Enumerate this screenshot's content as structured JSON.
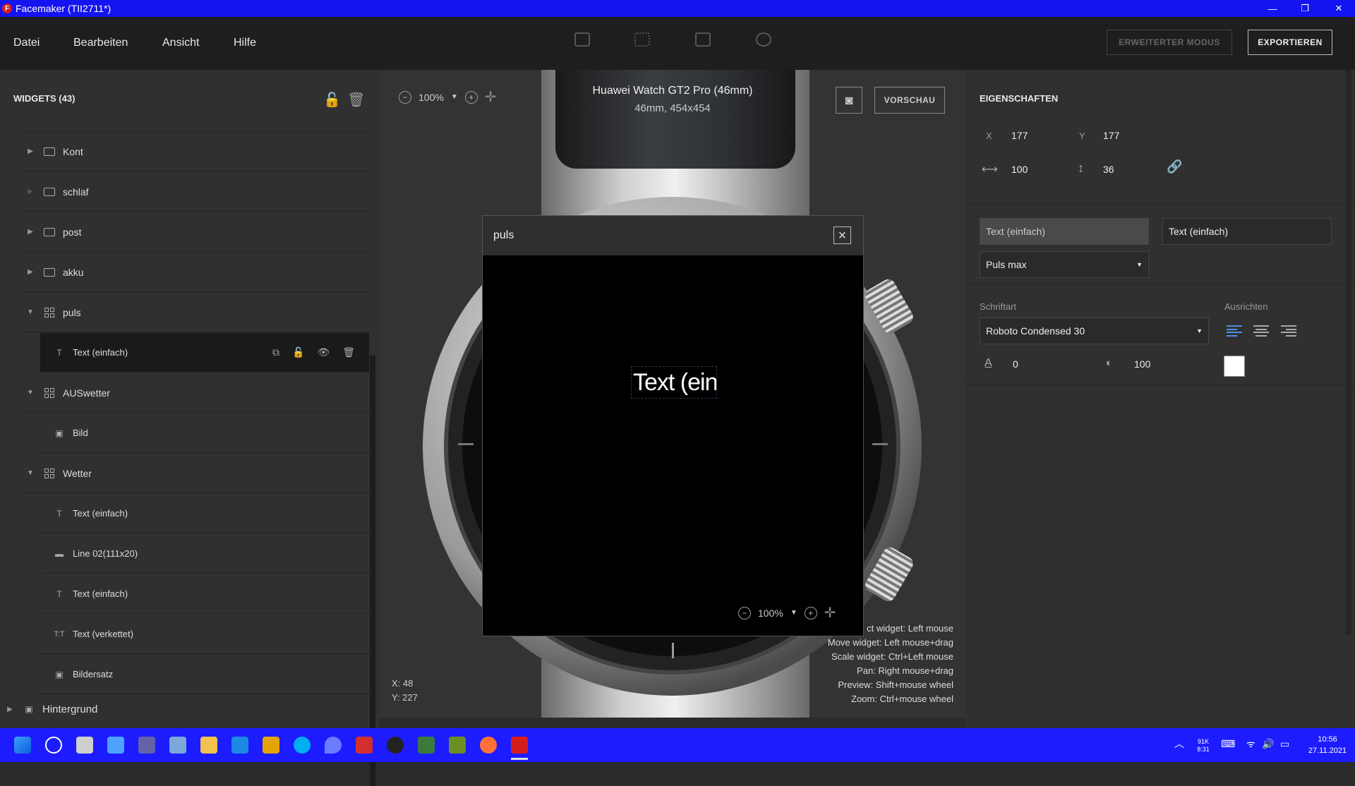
{
  "window": {
    "title": "Facemaker (TII2711*)",
    "icon_letter": "F"
  },
  "menu": [
    "Datei",
    "Bearbeiten",
    "Ansicht",
    "Hilfe"
  ],
  "header_buttons": {
    "advanced": "ERWEITERTER MODUS",
    "export": "EXPORTIEREN"
  },
  "widgets": {
    "title": "WIDGETS (43)",
    "items": [
      {
        "label": "Kont",
        "type": "folder"
      },
      {
        "label": "schlaf",
        "type": "folder"
      },
      {
        "label": "post",
        "type": "folder"
      },
      {
        "label": "akku",
        "type": "folder"
      },
      {
        "label": "puls",
        "type": "group"
      },
      {
        "label": "Text (einfach)",
        "type": "text",
        "selected": true
      },
      {
        "label": "AUSwetter",
        "type": "group"
      },
      {
        "label": "Bild",
        "type": "image"
      },
      {
        "label": "Wetter",
        "type": "group"
      },
      {
        "label": "Text (einfach)",
        "type": "text"
      },
      {
        "label": "Line 02(111x20)",
        "type": "line"
      },
      {
        "label": "Text (einfach)",
        "type": "text"
      },
      {
        "label": "Text (verkettet)",
        "type": "text-chain"
      },
      {
        "label": "Bildersatz",
        "type": "image"
      },
      {
        "label": "Hintergrund",
        "type": "image"
      }
    ]
  },
  "canvas": {
    "zoom": "100%",
    "device_name": "Huawei Watch GT2 Pro (46mm)",
    "device_spec": "46mm, 454x454",
    "preview_button": "VORSCHAU",
    "coords": {
      "x": "X: 48",
      "y": "Y: 227"
    },
    "hints": [
      "ct widget: Left mouse",
      "Move widget: Left mouse+drag",
      "Scale widget: Ctrl+Left mouse",
      "Pan: Right mouse+drag",
      "Preview: Shift+mouse wheel",
      "Zoom: Ctrl+mouse wheel"
    ]
  },
  "dialog": {
    "title": "puls",
    "preview_text": "Text (ein",
    "zoom": "100%"
  },
  "properties": {
    "title": "EIGENSCHAFTEN",
    "x_label": "X",
    "x": "177",
    "y_label": "Y",
    "y": "177",
    "width": "100",
    "height": "36",
    "type_field": "Text (einfach)",
    "name_field": "Text (einfach)",
    "data_select": "Puls max",
    "font_label": "Schriftart",
    "font_value": "Roboto Condensed 30",
    "align_label": "Ausrichten",
    "spacing": "0",
    "opacity": "100",
    "color": "#ffffff"
  },
  "tray": {
    "time": "10:56",
    "date": "27.11.2021",
    "kb": "91K\n8:31"
  }
}
